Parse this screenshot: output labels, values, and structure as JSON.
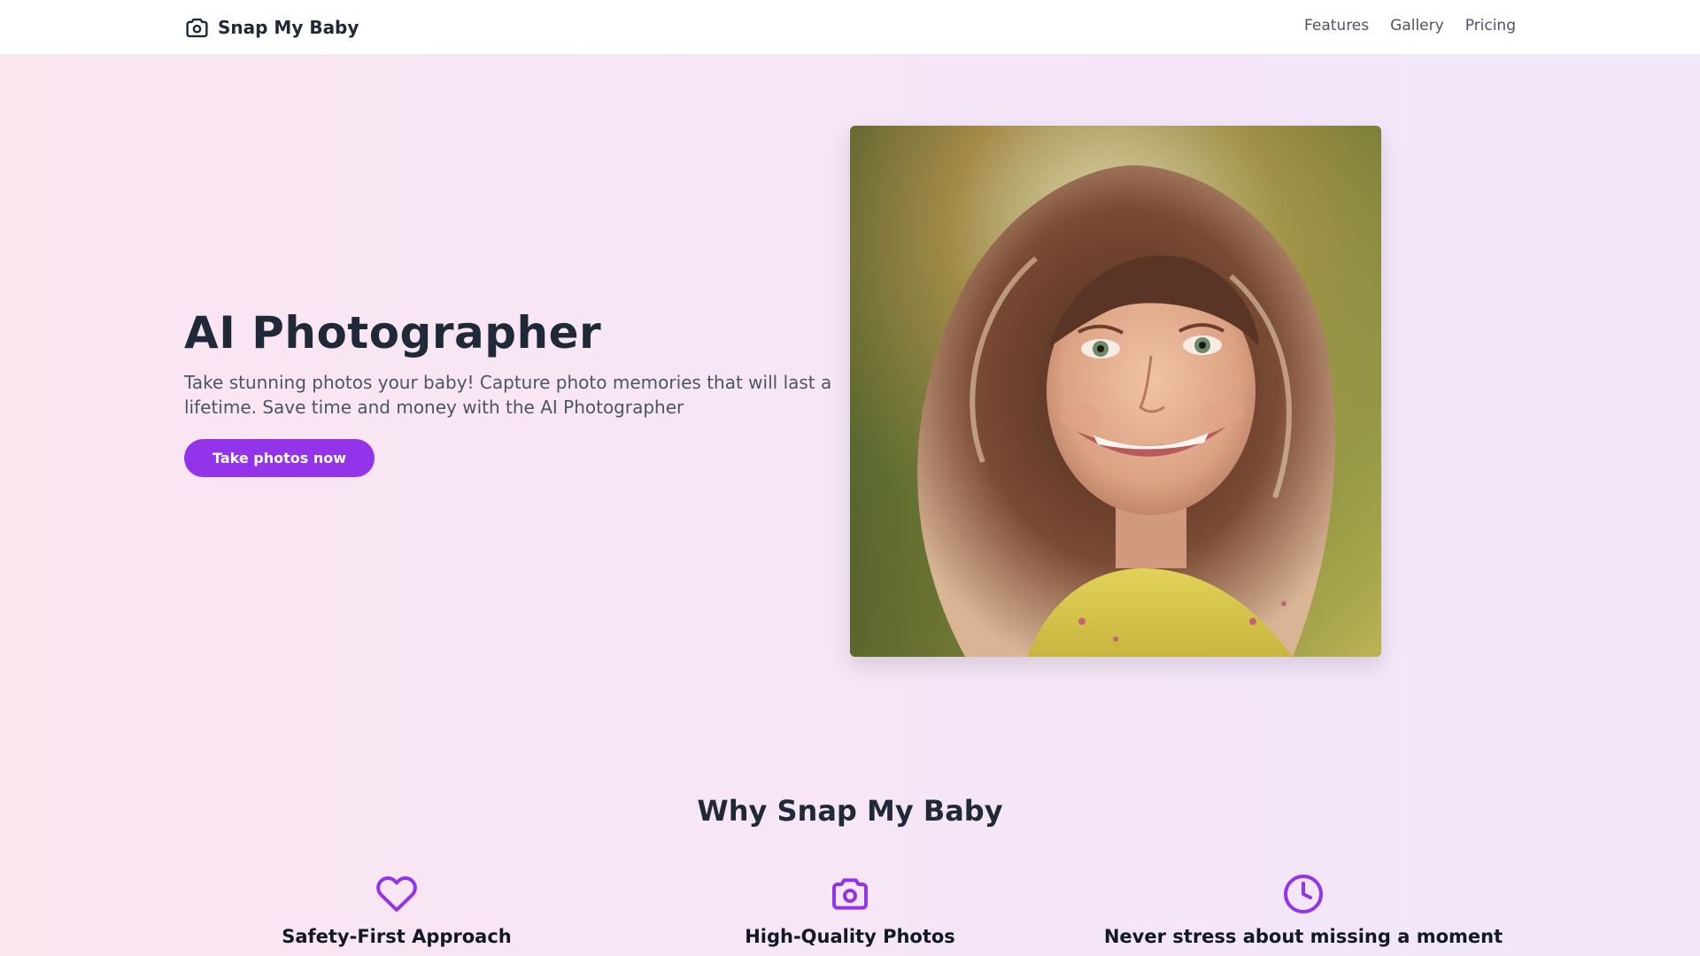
{
  "brand": {
    "name": "Snap My Baby",
    "icon": "camera-icon"
  },
  "nav": {
    "links": [
      "Features",
      "Gallery",
      "Pricing"
    ]
  },
  "hero": {
    "title": "AI Photographer",
    "subtitle": "Take stunning photos your baby! Capture photo memories that will last a lifetime. Save time and money with the AI Photographer",
    "cta_label": "Take photos now"
  },
  "features_section": {
    "title": "Why Snap My Baby",
    "items": [
      {
        "icon": "heart-icon",
        "title": "Safety-First Approach"
      },
      {
        "icon": "camera-icon",
        "title": "High-Quality Photos"
      },
      {
        "icon": "clock-icon",
        "title": "Never stress about missing a moment"
      }
    ]
  },
  "colors": {
    "accent": "#9333ea",
    "text_dark": "#1f2937",
    "text_muted": "#4b5563",
    "background_gradient": [
      "#fbe6f0",
      "#f1e6fa"
    ]
  }
}
